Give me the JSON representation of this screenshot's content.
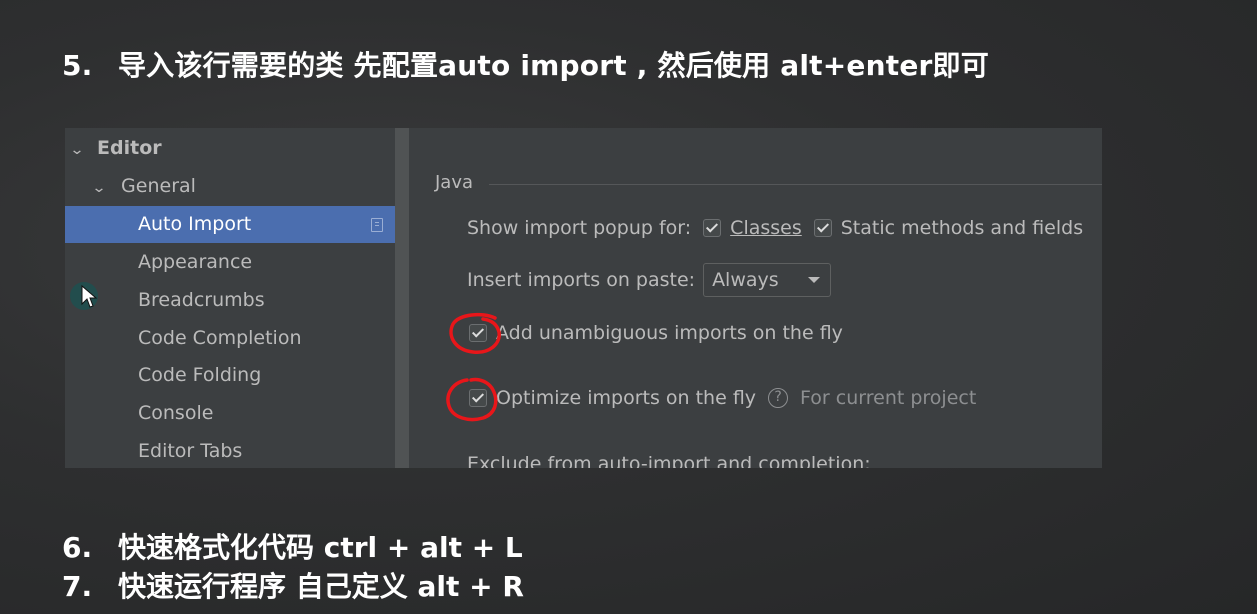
{
  "heading": {
    "number": "5.",
    "text": "导入该行需要的类 先配置auto import , 然后使用 alt+enter即可"
  },
  "tree": {
    "items": [
      {
        "label": "Editor",
        "expanded": true,
        "level": 0,
        "selected": false
      },
      {
        "label": "General",
        "expanded": true,
        "level": 1,
        "selected": false
      },
      {
        "label": "Auto Import",
        "level": 2,
        "selected": true
      },
      {
        "label": "Appearance",
        "level": 2,
        "selected": false
      },
      {
        "label": "Breadcrumbs",
        "level": 2,
        "selected": false
      },
      {
        "label": "Code Completion",
        "level": 2,
        "selected": false
      },
      {
        "label": "Code Folding",
        "level": 2,
        "selected": false
      },
      {
        "label": "Console",
        "level": 2,
        "selected": false
      },
      {
        "label": "Editor Tabs",
        "level": 2,
        "selected": false
      }
    ],
    "icons": {
      "expand": "chevron-down-icon",
      "copy": "copy-icon"
    }
  },
  "settings": {
    "section": "Java",
    "show_import_popup": {
      "label": "Show import popup for:",
      "classes": {
        "label": "Classes",
        "checked": true
      },
      "static": {
        "label": "Static methods and fields",
        "checked": true
      }
    },
    "insert_imports": {
      "label": "Insert imports on paste:",
      "value": "Always"
    },
    "add_unambiguous": {
      "label": "Add unambiguous imports on the fly",
      "checked": true
    },
    "optimize": {
      "label": "Optimize imports on the fly",
      "checked": true,
      "hint": "For current project"
    },
    "exclude_label": "Exclude from auto-import and completion:",
    "help_icon": "?"
  },
  "bottom": [
    {
      "number": "6.",
      "text": "快速格式化代码 ctrl + alt + L"
    },
    {
      "number": "7.",
      "text": "快速运行程序 自己定义 alt + R"
    }
  ],
  "colors": {
    "selection": "#4b6eaf",
    "annotation": "#e8161a",
    "panel": "#3c3f41"
  }
}
